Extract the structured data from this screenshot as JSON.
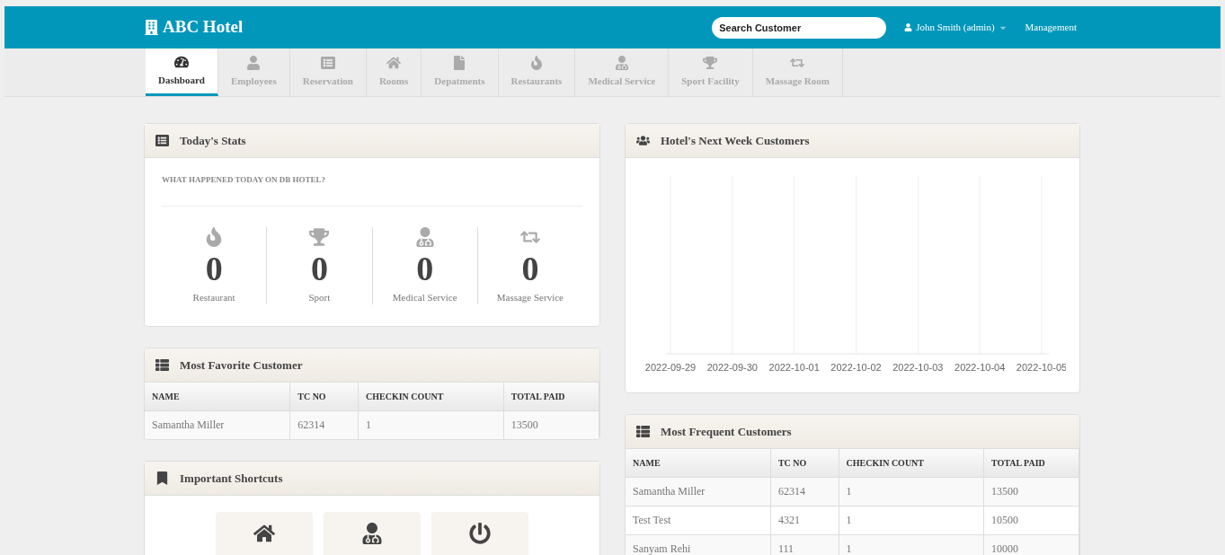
{
  "header": {
    "brand": "ABC Hotel",
    "search": {
      "placeholder": "Search Customer"
    },
    "user": "John Smith (admin)",
    "management": "Management"
  },
  "tabs": [
    {
      "label": "Dashboard",
      "selected": true
    },
    {
      "label": "Employees",
      "selected": false
    },
    {
      "label": "Reservation",
      "selected": false
    },
    {
      "label": "Rooms",
      "selected": false
    },
    {
      "label": "Depatments",
      "selected": false
    },
    {
      "label": "Restaurants",
      "selected": false
    },
    {
      "label": "Medical Service",
      "selected": false
    },
    {
      "label": "Sport Facility",
      "selected": false
    },
    {
      "label": "Massage Room",
      "selected": false
    }
  ],
  "todays_stats": {
    "title": "Today's Stats",
    "subtitle": "WHAT HAPPENED TODAY ON DB HOTEL?",
    "stats": [
      {
        "value": "0",
        "label": "Restaurant"
      },
      {
        "value": "0",
        "label": "Sport"
      },
      {
        "value": "0",
        "label": "Medical Service"
      },
      {
        "value": "0",
        "label": "Massage Service"
      }
    ]
  },
  "favorite_customer": {
    "title": "Most Favorite Customer",
    "columns": [
      "NAME",
      "TC NO",
      "CHECKIN COUNT",
      "TOTAL PAID"
    ],
    "rows": [
      [
        "Samantha Miller",
        "62314",
        "1",
        "13500"
      ]
    ]
  },
  "shortcuts": {
    "title": "Important Shortcuts"
  },
  "next_week": {
    "title": "Hotel's Next Week Customers",
    "axis_labels": [
      "2022-09-29",
      "2022-09-30",
      "2022-10-01",
      "2022-10-02",
      "2022-10-03",
      "2022-10-04",
      "2022-10-05"
    ]
  },
  "frequent_customers": {
    "title": "Most Frequent Customers",
    "columns": [
      "NAME",
      "TC NO",
      "CHECKIN COUNT",
      "TOTAL PAID"
    ],
    "rows": [
      [
        "Samantha Miller",
        "62314",
        "1",
        "13500"
      ],
      [
        "Test Test",
        "4321",
        "1",
        "10500"
      ],
      [
        "Sanyam Rehi",
        "111",
        "1",
        "10000"
      ]
    ]
  }
}
